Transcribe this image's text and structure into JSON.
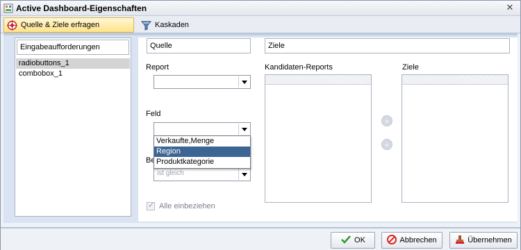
{
  "window": {
    "title": "Active Dashboard-Eigenschaften"
  },
  "tabs": [
    {
      "label": "Quelle & Ziele erfragen"
    },
    {
      "label": "Kaskaden"
    }
  ],
  "left": {
    "header": "Eingabeaufforderungen",
    "items": [
      "radiobuttons_1",
      "combobox_1"
    ]
  },
  "source": {
    "header": "Quelle",
    "report_label": "Report",
    "field_label": "Feld",
    "hidden_label_prefix": "Be",
    "hidden_combo_value": "ist gleich",
    "field_options": [
      "Verkaufte,Menge",
      "Region",
      "Produktkategorie"
    ],
    "selected_option": "Region"
  },
  "targets": {
    "header": "Ziele",
    "candidates_label": "Kandidaten-Reports",
    "targets_label": "Ziele",
    "include_all_label": "Alle einbeziehen"
  },
  "buttons": {
    "ok": "OK",
    "cancel": "Abbrechen",
    "apply": "Übernehmen"
  },
  "colors": {
    "selection": "#3d6593",
    "active_tab": "#ffe48a",
    "content_bg": "#d9e3f1"
  }
}
